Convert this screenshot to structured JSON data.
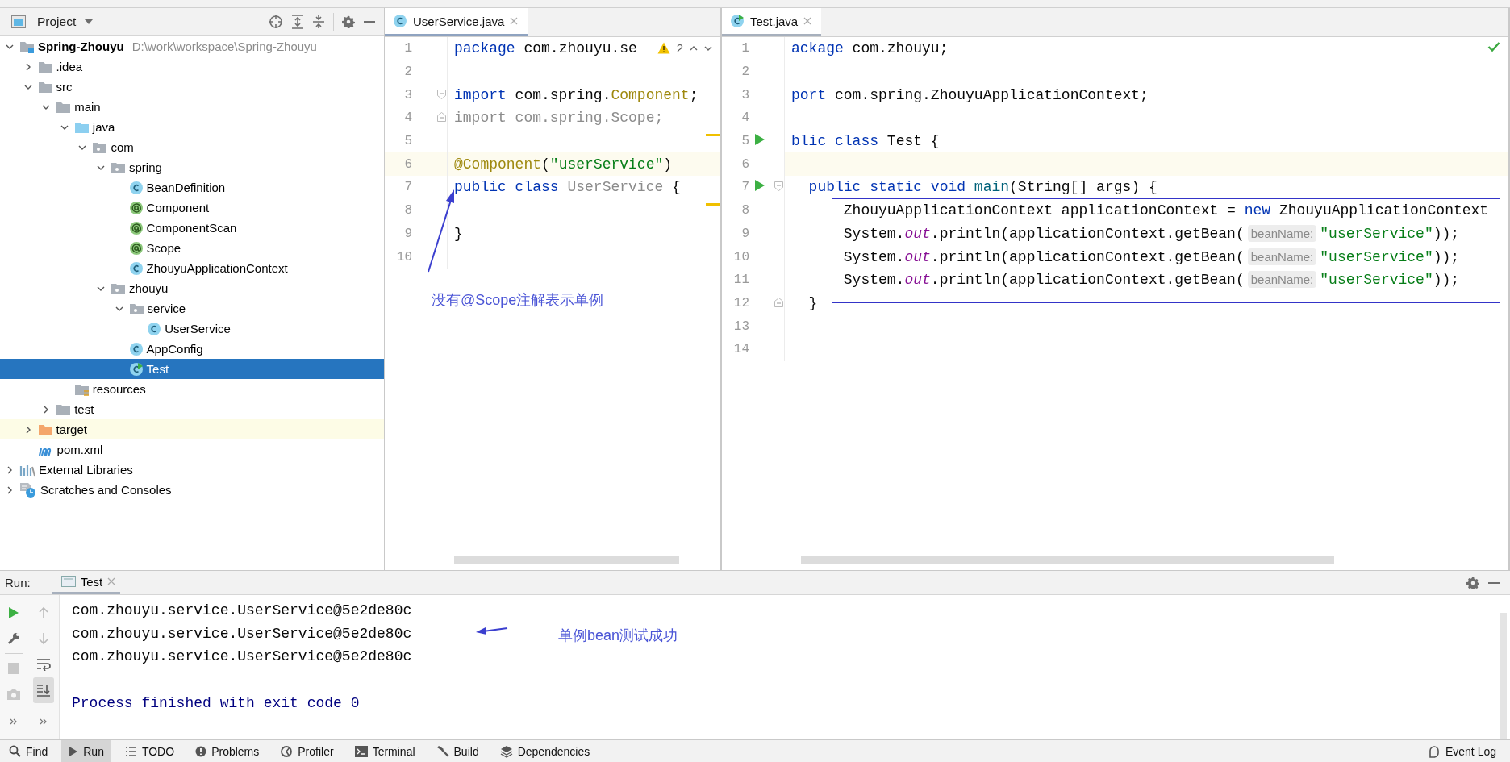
{
  "project_panel": {
    "title": "Project",
    "tree": [
      {
        "label": "Spring-Zhouyu",
        "path": "D:\\work\\workspace\\Spring-Zhouyu",
        "kind": "module",
        "expanded": true,
        "selected": false,
        "highlighted": false,
        "children": [
          {
            "label": ".idea",
            "kind": "folder",
            "expanded": false,
            "selected": false,
            "highlighted": false
          },
          {
            "label": "src",
            "kind": "folder",
            "expanded": true,
            "selected": false,
            "highlighted": false,
            "children": [
              {
                "label": "main",
                "kind": "folder",
                "expanded": true,
                "selected": false,
                "highlighted": false,
                "children": [
                  {
                    "label": "java",
                    "kind": "source",
                    "expanded": true,
                    "selected": false,
                    "highlighted": false,
                    "children": [
                      {
                        "label": "com",
                        "kind": "package",
                        "expanded": true,
                        "selected": false,
                        "highlighted": false,
                        "children": [
                          {
                            "label": "spring",
                            "kind": "package",
                            "expanded": true,
                            "selected": false,
                            "highlighted": false,
                            "children": [
                              {
                                "label": "BeanDefinition",
                                "kind": "class",
                                "selected": false,
                                "highlighted": false
                              },
                              {
                                "label": "Component",
                                "kind": "annotation",
                                "selected": false,
                                "highlighted": false
                              },
                              {
                                "label": "ComponentScan",
                                "kind": "annotation",
                                "selected": false,
                                "highlighted": false
                              },
                              {
                                "label": "Scope",
                                "kind": "annotation",
                                "selected": false,
                                "highlighted": false
                              },
                              {
                                "label": "ZhouyuApplicationContext",
                                "kind": "class",
                                "selected": false,
                                "highlighted": false
                              }
                            ]
                          },
                          {
                            "label": "zhouyu",
                            "kind": "package",
                            "expanded": true,
                            "selected": false,
                            "highlighted": false,
                            "children": [
                              {
                                "label": "service",
                                "kind": "package",
                                "expanded": true,
                                "selected": false,
                                "highlighted": false,
                                "children": [
                                  {
                                    "label": "UserService",
                                    "kind": "class",
                                    "selected": false,
                                    "highlighted": false
                                  }
                                ]
                              },
                              {
                                "label": "AppConfig",
                                "kind": "class",
                                "selected": false,
                                "highlighted": false
                              },
                              {
                                "label": "Test",
                                "kind": "runnable",
                                "selected": true,
                                "highlighted": false
                              }
                            ]
                          }
                        ]
                      }
                    ]
                  },
                  {
                    "label": "resources",
                    "kind": "resources",
                    "selected": false,
                    "highlighted": false
                  }
                ]
              },
              {
                "label": "test",
                "kind": "folder",
                "expanded": false,
                "selected": false,
                "highlighted": false
              }
            ]
          },
          {
            "label": "target",
            "kind": "excluded",
            "expanded": false,
            "selected": false,
            "highlighted": true
          },
          {
            "label": "pom.xml",
            "kind": "maven",
            "selected": false,
            "highlighted": false
          }
        ]
      },
      {
        "label": "External Libraries",
        "kind": "libraries",
        "expanded": false,
        "selected": false,
        "highlighted": false
      },
      {
        "label": "Scratches and Consoles",
        "kind": "scratches",
        "expanded": false,
        "selected": false,
        "highlighted": false
      }
    ]
  },
  "editors": [
    {
      "tab": "UserService.java",
      "focused": true,
      "inspection": {
        "kind": "warnings",
        "count": "2"
      },
      "callout": "没有@Scope注解表示单例",
      "lines": [
        {
          "number": "1",
          "current": false,
          "fold_start": false,
          "fold_end": false,
          "tokens": [
            {
              "text": "package",
              "kind": "keyword"
            },
            {
              "text": " com.zhouyu.se",
              "kind": "plain"
            }
          ]
        },
        {
          "number": "2",
          "current": false,
          "fold_start": false,
          "fold_end": false
        },
        {
          "number": "3",
          "current": false,
          "fold_start": true,
          "fold_end": false,
          "tokens": [
            {
              "text": "import",
              "kind": "keyword"
            },
            {
              "text": " com.spring.",
              "kind": "plain"
            },
            {
              "text": "Component",
              "kind": "annotation"
            },
            {
              "text": ";",
              "kind": "plain"
            }
          ]
        },
        {
          "number": "4",
          "current": false,
          "fold_start": false,
          "fold_end": true,
          "tokens": [
            {
              "text": "import com.spring.Scope;",
              "kind": "unused"
            }
          ]
        },
        {
          "number": "5",
          "current": false,
          "fold_start": false,
          "fold_end": false
        },
        {
          "number": "6",
          "current": true,
          "fold_start": false,
          "fold_end": false,
          "tokens": [
            {
              "text": "@Component",
              "kind": "annotation"
            },
            {
              "text": "(",
              "kind": "plain"
            },
            {
              "text": "\"userService\"",
              "kind": "string"
            },
            {
              "text": ")",
              "kind": "plain"
            }
          ]
        },
        {
          "number": "7",
          "current": false,
          "fold_start": false,
          "fold_end": false,
          "tokens": [
            {
              "text": "public class ",
              "kind": "keyword"
            },
            {
              "text": "UserService",
              "kind": "unused"
            },
            {
              "text": " {",
              "kind": "plain"
            }
          ]
        },
        {
          "number": "8",
          "current": false,
          "fold_start": false,
          "fold_end": false
        },
        {
          "number": "9",
          "current": false,
          "fold_start": false,
          "fold_end": false,
          "tokens": [
            {
              "text": "}",
              "kind": "plain"
            }
          ]
        },
        {
          "number": "10",
          "current": false,
          "fold_start": false,
          "fold_end": false
        }
      ]
    },
    {
      "tab": "Test.java",
      "focused": false,
      "inspection": {
        "kind": "ok"
      },
      "lines": [
        {
          "number": "1",
          "current": false,
          "boxed": false,
          "run": false,
          "fold_start": false,
          "fold_end": false,
          "tokens": [
            {
              "text": "ackage",
              "kind": "keyword"
            },
            {
              "text": " com.zhouyu;",
              "kind": "plain"
            }
          ]
        },
        {
          "number": "2",
          "current": false,
          "boxed": false,
          "run": false,
          "fold_start": false,
          "fold_end": false
        },
        {
          "number": "3",
          "current": false,
          "boxed": false,
          "run": false,
          "fold_start": false,
          "fold_end": false,
          "tokens": [
            {
              "text": "port",
              "kind": "keyword"
            },
            {
              "text": " com.spring.ZhouyuApplicationContext;",
              "kind": "plain"
            }
          ]
        },
        {
          "number": "4",
          "current": false,
          "boxed": false,
          "run": false,
          "fold_start": false,
          "fold_end": false
        },
        {
          "number": "5",
          "current": false,
          "boxed": false,
          "run": true,
          "fold_start": false,
          "fold_end": false,
          "tokens": [
            {
              "text": "blic class",
              "kind": "keyword"
            },
            {
              "text": " Test {",
              "kind": "plain"
            }
          ]
        },
        {
          "number": "6",
          "current": true,
          "boxed": false,
          "run": false,
          "fold_start": false,
          "fold_end": false
        },
        {
          "number": "7",
          "current": false,
          "boxed": false,
          "run": true,
          "fold_start": true,
          "fold_end": false,
          "tokens": [
            {
              "text": "  public static void",
              "kind": "keyword"
            },
            {
              "text": " main",
              "kind": "method"
            },
            {
              "text": "(String[] args) {",
              "kind": "plain"
            }
          ]
        },
        {
          "number": "8",
          "current": false,
          "boxed": true,
          "run": false,
          "fold_start": false,
          "fold_end": false,
          "tokens": [
            {
              "text": "      ZhouyuApplicationContext applicationContext = ",
              "kind": "plain"
            },
            {
              "text": "new",
              "kind": "keyword"
            },
            {
              "text": " ZhouyuApplicationContext",
              "kind": "plain"
            }
          ]
        },
        {
          "number": "9",
          "current": false,
          "boxed": true,
          "run": false,
          "fold_start": false,
          "fold_end": false,
          "tokens": [
            {
              "text": "      System.",
              "kind": "plain"
            },
            {
              "text": "out",
              "kind": "field"
            },
            {
              "text": ".println(applicationContext.getBean(",
              "kind": "plain"
            },
            {
              "text": "beanName:",
              "kind": "hint"
            },
            {
              "text": "\"userService\"",
              "kind": "string"
            },
            {
              "text": "));",
              "kind": "plain"
            }
          ]
        },
        {
          "number": "10",
          "current": false,
          "boxed": true,
          "run": false,
          "fold_start": false,
          "fold_end": false,
          "tokens": [
            {
              "text": "      System.",
              "kind": "plain"
            },
            {
              "text": "out",
              "kind": "field"
            },
            {
              "text": ".println(applicationContext.getBean(",
              "kind": "plain"
            },
            {
              "text": "beanName:",
              "kind": "hint"
            },
            {
              "text": "\"userService\"",
              "kind": "string"
            },
            {
              "text": "));",
              "kind": "plain"
            }
          ]
        },
        {
          "number": "11",
          "current": false,
          "boxed": true,
          "run": false,
          "fold_start": false,
          "fold_end": false,
          "tokens": [
            {
              "text": "      System.",
              "kind": "plain"
            },
            {
              "text": "out",
              "kind": "field"
            },
            {
              "text": ".println(applicationContext.getBean(",
              "kind": "plain"
            },
            {
              "text": "beanName:",
              "kind": "hint"
            },
            {
              "text": "\"userService\"",
              "kind": "string"
            },
            {
              "text": "));",
              "kind": "plain"
            }
          ]
        },
        {
          "number": "12",
          "current": false,
          "boxed": true,
          "run": false,
          "fold_start": false,
          "fold_end": true,
          "tokens": [
            {
              "text": "  }",
              "kind": "plain"
            }
          ]
        },
        {
          "number": "13",
          "current": false,
          "boxed": false,
          "run": false,
          "fold_start": false,
          "fold_end": false
        },
        {
          "number": "14",
          "current": false,
          "boxed": false,
          "run": false,
          "fold_start": false,
          "fold_end": false
        }
      ]
    }
  ],
  "run_panel": {
    "label": "Run:",
    "tab": "Test",
    "scroll_to_end": true,
    "callout": "单例bean测试成功",
    "output": [
      {
        "text": "com.zhouyu.service.UserService@5e2de80c",
        "kind": "stdout"
      },
      {
        "text": "com.zhouyu.service.UserService@5e2de80c",
        "kind": "stdout"
      },
      {
        "text": "com.zhouyu.service.UserService@5e2de80c",
        "kind": "stdout"
      },
      {
        "text": "Process finished with exit code 0",
        "kind": "system"
      }
    ]
  },
  "status_bar": {
    "tools": [
      {
        "label": "Find",
        "kind": "search",
        "selected": false
      },
      {
        "label": "Run",
        "kind": "run",
        "selected": true
      },
      {
        "label": "TODO",
        "kind": "list",
        "selected": false
      },
      {
        "label": "Problems",
        "kind": "problems",
        "selected": false
      },
      {
        "label": "Profiler",
        "kind": "profiler",
        "selected": false
      },
      {
        "label": "Terminal",
        "kind": "terminal",
        "selected": false
      },
      {
        "label": "Build",
        "kind": "build",
        "selected": false
      },
      {
        "label": "Dependencies",
        "kind": "layers",
        "selected": false
      }
    ],
    "event_log": "Event Log"
  }
}
